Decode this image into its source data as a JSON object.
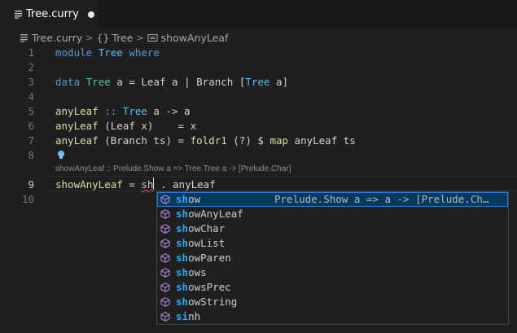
{
  "tab": {
    "label": "Tree.curry"
  },
  "breadcrumb": {
    "file": "Tree.curry",
    "module": "Tree",
    "symbol": "showAnyLeaf"
  },
  "editor": {
    "line_numbers": [
      "1",
      "2",
      "3",
      "4",
      "5",
      "6",
      "7",
      "8",
      "9",
      "10"
    ],
    "lines": [
      [
        {
          "t": "module ",
          "c": "kw"
        },
        {
          "t": "Tree",
          "c": "ty2"
        },
        {
          "t": " where",
          "c": "kw"
        }
      ],
      [],
      [
        {
          "t": "data ",
          "c": "kw"
        },
        {
          "t": "Tree",
          "c": "ty"
        },
        {
          "t": " a = ",
          "c": "lt"
        },
        {
          "t": "Leaf",
          "c": "lt"
        },
        {
          "t": " a | ",
          "c": "lt"
        },
        {
          "t": "Branch",
          "c": "lt"
        },
        {
          "t": " [",
          "c": "lt"
        },
        {
          "t": "Tree",
          "c": "ty2"
        },
        {
          "t": " a]",
          "c": "lt"
        }
      ],
      [],
      [
        {
          "t": "anyLeaf",
          "c": "fn"
        },
        {
          "t": " :: ",
          "c": "kw"
        },
        {
          "t": "Tree",
          "c": "ty2"
        },
        {
          "t": " a -> a",
          "c": "lt"
        }
      ],
      [
        {
          "t": "anyLeaf",
          "c": "fn"
        },
        {
          "t": " (",
          "c": "lt"
        },
        {
          "t": "Leaf",
          "c": "lt"
        },
        {
          "t": " x)    = x",
          "c": "lt"
        }
      ],
      [
        {
          "t": "anyLeaf",
          "c": "fn"
        },
        {
          "t": " (",
          "c": "lt"
        },
        {
          "t": "Branch",
          "c": "lt"
        },
        {
          "t": " ts) = ",
          "c": "lt"
        },
        {
          "t": "foldr1",
          "c": "fn"
        },
        {
          "t": " (?) $ ",
          "c": "lt"
        },
        {
          "t": "map",
          "c": "fn"
        },
        {
          "t": " anyLeaf ts",
          "c": "lt"
        }
      ],
      [],
      [
        {
          "t": "showAnyLeaf",
          "c": "fn"
        },
        {
          "t": " = ",
          "c": "lt"
        }
      ],
      []
    ],
    "typed_prefix": "sh",
    "after_cursor": " . anyLeaf",
    "inlay_hint": "showAnyLeaf :: Prelude.Show a => Tree.Tree a -> [Prelude.Char]"
  },
  "suggestions": [
    {
      "match": "sh",
      "rest": "ow",
      "detail": "Prelude.Show a => a -> [Prelude.Ch…",
      "selected": true
    },
    {
      "match": "sh",
      "rest": "owAnyLeaf",
      "detail": ""
    },
    {
      "match": "sh",
      "rest": "owChar",
      "detail": ""
    },
    {
      "match": "sh",
      "rest": "owList",
      "detail": ""
    },
    {
      "match": "sh",
      "rest": "owParen",
      "detail": ""
    },
    {
      "match": "sh",
      "rest": "ows",
      "detail": ""
    },
    {
      "match": "sh",
      "rest": "owsPrec",
      "detail": ""
    },
    {
      "match": "sh",
      "rest": "owString",
      "detail": ""
    },
    {
      "match": "si",
      "rest": "nh",
      "detail": ""
    }
  ]
}
